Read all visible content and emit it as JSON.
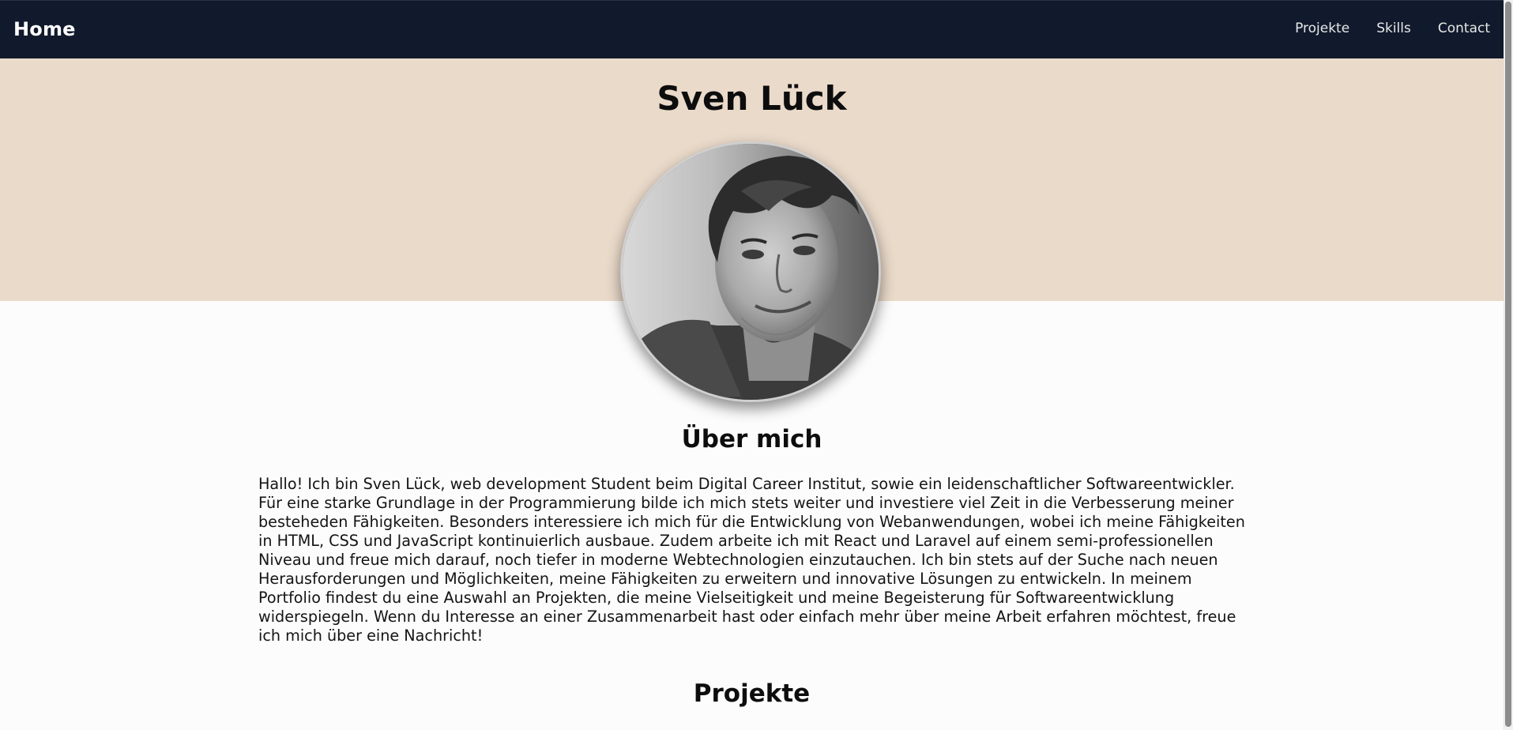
{
  "nav": {
    "brand": "Home",
    "links": [
      "Projekte",
      "Skills",
      "Contact"
    ]
  },
  "hero": {
    "title": "Sven Lück"
  },
  "about": {
    "title": "Über mich",
    "text": "Hallo! Ich bin Sven Lück, web development Student beim Digital Career Institut, sowie ein leidenschaftlicher Softwareentwickler. Für eine starke Grundlage in der Programmierung bilde ich mich stets weiter und investiere viel Zeit in die Verbesserung meiner besteheden Fähigkeiten. Besonders interessiere ich mich für die Entwicklung von Webanwendungen, wobei ich meine Fähigkeiten in HTML, CSS und JavaScript kontinuierlich ausbaue. Zudem arbeite ich mit React und Laravel auf einem semi-professionellen Niveau und freue mich darauf, noch tiefer in moderne Webtechnologien einzutauchen. Ich bin stets auf der Suche nach neuen Herausforderungen und Möglichkeiten, meine Fähigkeiten zu erweitern und innovative Lösungen zu entwickeln. In meinem Portfolio findest du eine Auswahl an Projekten, die meine Vielseitigkeit und meine Begeisterung für Softwareentwicklung widerspiegeln. Wenn du Interesse an einer Zusammenarbeit hast oder einfach mehr über meine Arbeit erfahren möchtest, freue ich mich über eine Nachricht!"
  },
  "projects": {
    "title": "Projekte"
  },
  "colors": {
    "navbar": "#111a2c",
    "hero_bg": "#eadaca",
    "page_bg": "#fcfcfc"
  }
}
